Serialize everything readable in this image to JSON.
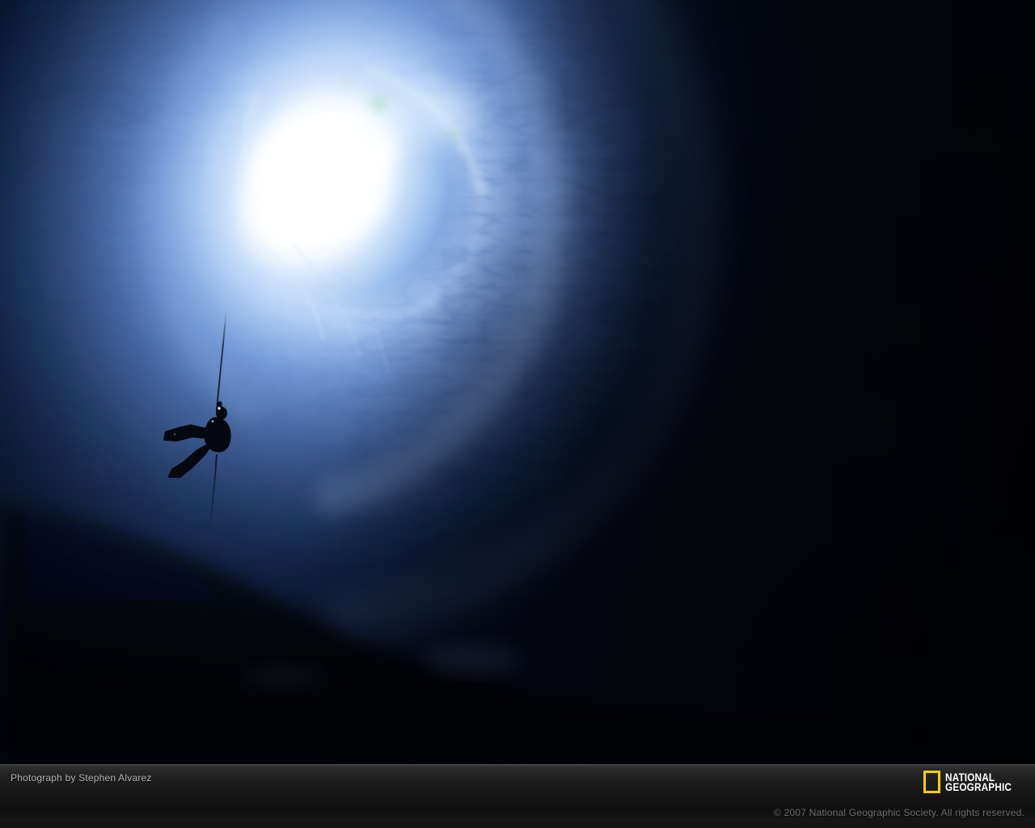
{
  "photo": {
    "alt": "Silhouette of a caver rappelling on a single rope into a vast dark cave, far below a bright blue-white sinkhole opening that floods the swirling rock walls with daylight"
  },
  "footer": {
    "credit": "Photograph by Stephen Alvarez",
    "copyright": "© 2007 National Geographic Society. All rights reserved.",
    "logo": {
      "line1": "NATIONAL",
      "line2": "GEOGRAPHIC"
    }
  },
  "colors": {
    "logo_frame_yellow": "#ffce00",
    "logo_text": "#ffffff",
    "credit_text": "#b3b3b6",
    "copyright_text": "#6e6e6e",
    "bar_background": "#1a1a1a",
    "cave_opening": "#ffffff",
    "cave_light_blue": "#9ec2ef",
    "cave_mid_blue": "#45659f",
    "cave_dark": "#04091a"
  }
}
